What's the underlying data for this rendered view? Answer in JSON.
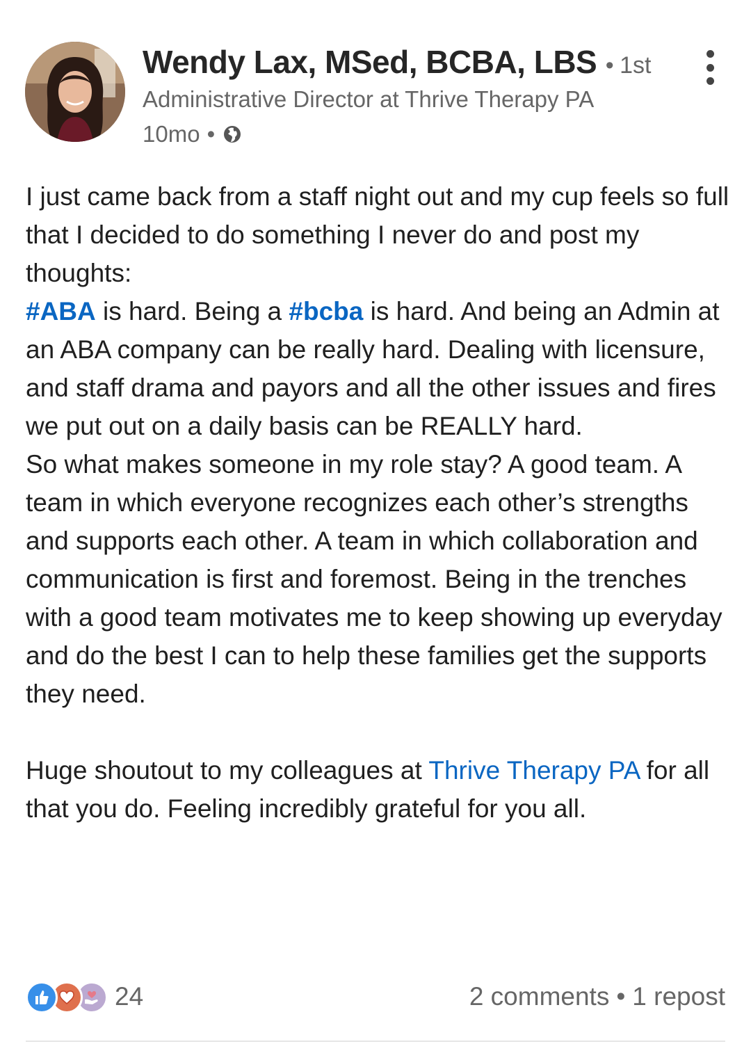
{
  "post": {
    "author": {
      "name": "Wendy Lax, MSed, BCBA, LBS",
      "separator": "•",
      "degree": "1st",
      "headline": "Administrative Director at Thrive Therapy PA",
      "time": "10mo",
      "time_separator": "•",
      "visibility_icon": "globe-icon"
    },
    "menu_icon": "more-vertical-icon",
    "body": {
      "p1": "I just came back from a staff night out and my cup feels so full that I decided to do something I never do and post my thoughts:",
      "p2": {
        "hashtag1": "#ABA",
        "text1": " is hard. Being a ",
        "hashtag2": "#bcba",
        "text2": " is hard. And being an Admin at an ABA company can be really hard. Dealing with licensure, and staff drama and payors and all the other issues and fires we put out on a daily basis can be REALLY hard."
      },
      "p3": "So what makes someone in my role stay? A good team. A team in which everyone recognizes each other’s strengths and supports each other. A team in which collaboration and communication is first and foremost. Being in the trenches with a good team motivates me to keep showing up everyday and do the best I can to help these families get the supports they need.",
      "p4": {
        "text1": "Huge shoutout to my colleagues at ",
        "mention": "Thrive Therapy PA",
        "text2": " for all that you do. Feeling incredibly grateful for you all."
      }
    },
    "social": {
      "reaction_icons": [
        "like-icon",
        "love-icon",
        "support-icon"
      ],
      "reaction_count": "24",
      "comments": "2 comments",
      "bullet": "•",
      "reposts": "1 repost"
    },
    "colors": {
      "link": "#0a66c2",
      "secondary_text": "#666666",
      "like": "#378fe9",
      "love": "#df704d",
      "support": "#bba9d1"
    }
  }
}
